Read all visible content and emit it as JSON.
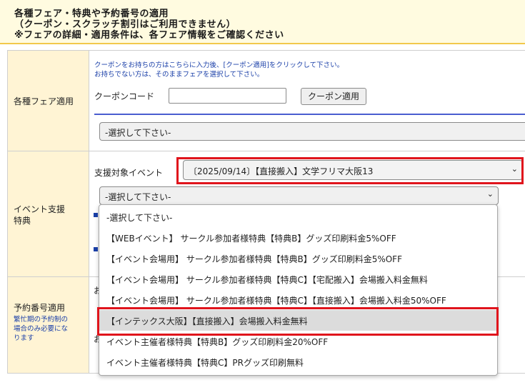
{
  "header": {
    "title": "各種フェア・特典や予約番号の適用",
    "note1": "（クーポン・スクラッチ割引はご利用できません）",
    "note2": "※フェアの詳細・適用条件は、各フェア情報をご確認ください"
  },
  "fair": {
    "label": "各種フェア適用",
    "instruction1": "クーポンをお持ちの方はこちらに入力後、[クーポン適用]をクリックして下さい。",
    "instruction2": "お持ちでない方は、そのままフェアを選択して下さい。",
    "coupon_label": "クーポンコード",
    "coupon_value": "",
    "apply_button": "クーポン適用",
    "fair_select": "-選択して下さい-"
  },
  "event": {
    "label_line1": "イベント支援",
    "label_line2": "特典",
    "target_label": "支援対象イベント",
    "target_select": "〔2025/09/14〕【直接搬入】文学フリマ大阪13",
    "benefit_select": "-選択して下さい-"
  },
  "reservation": {
    "label": "予約番号適用",
    "note_line1": "繁忙期の予約制の",
    "note_line2": "場合のみ必要にな",
    "note_line3": "ります",
    "fragment1": "お",
    "fragment2": "お"
  },
  "dropdown": {
    "options": [
      "-選択して下さい-",
      "【WEBイベント】 サークル参加者様特典【特典B】グッズ印刷料金5%OFF",
      "【イベント会場用】 サークル参加者様特典【特典B】グッズ印刷料金5%OFF",
      "【イベント会場用】 サークル参加者様特典【特典C】【宅配搬入】会場搬入料金無料",
      "【イベント会場用】 サークル参加者様特典【特典C】【直接搬入】会場搬入料金50%OFF",
      "【インテックス大阪】【直接搬入】会場搬入料金無料",
      "イベント主催者様特典【特典B】グッズ印刷料金20%OFF",
      "イベント主催者様特典【特典C】PRグッズ印刷無料"
    ],
    "highlighted_index": 5
  },
  "colors": {
    "header_bg": "#fffbe0",
    "label_bg": "#fff4d4",
    "highlight_red": "#e0141c",
    "instruction_blue": "#1a3fa8"
  }
}
